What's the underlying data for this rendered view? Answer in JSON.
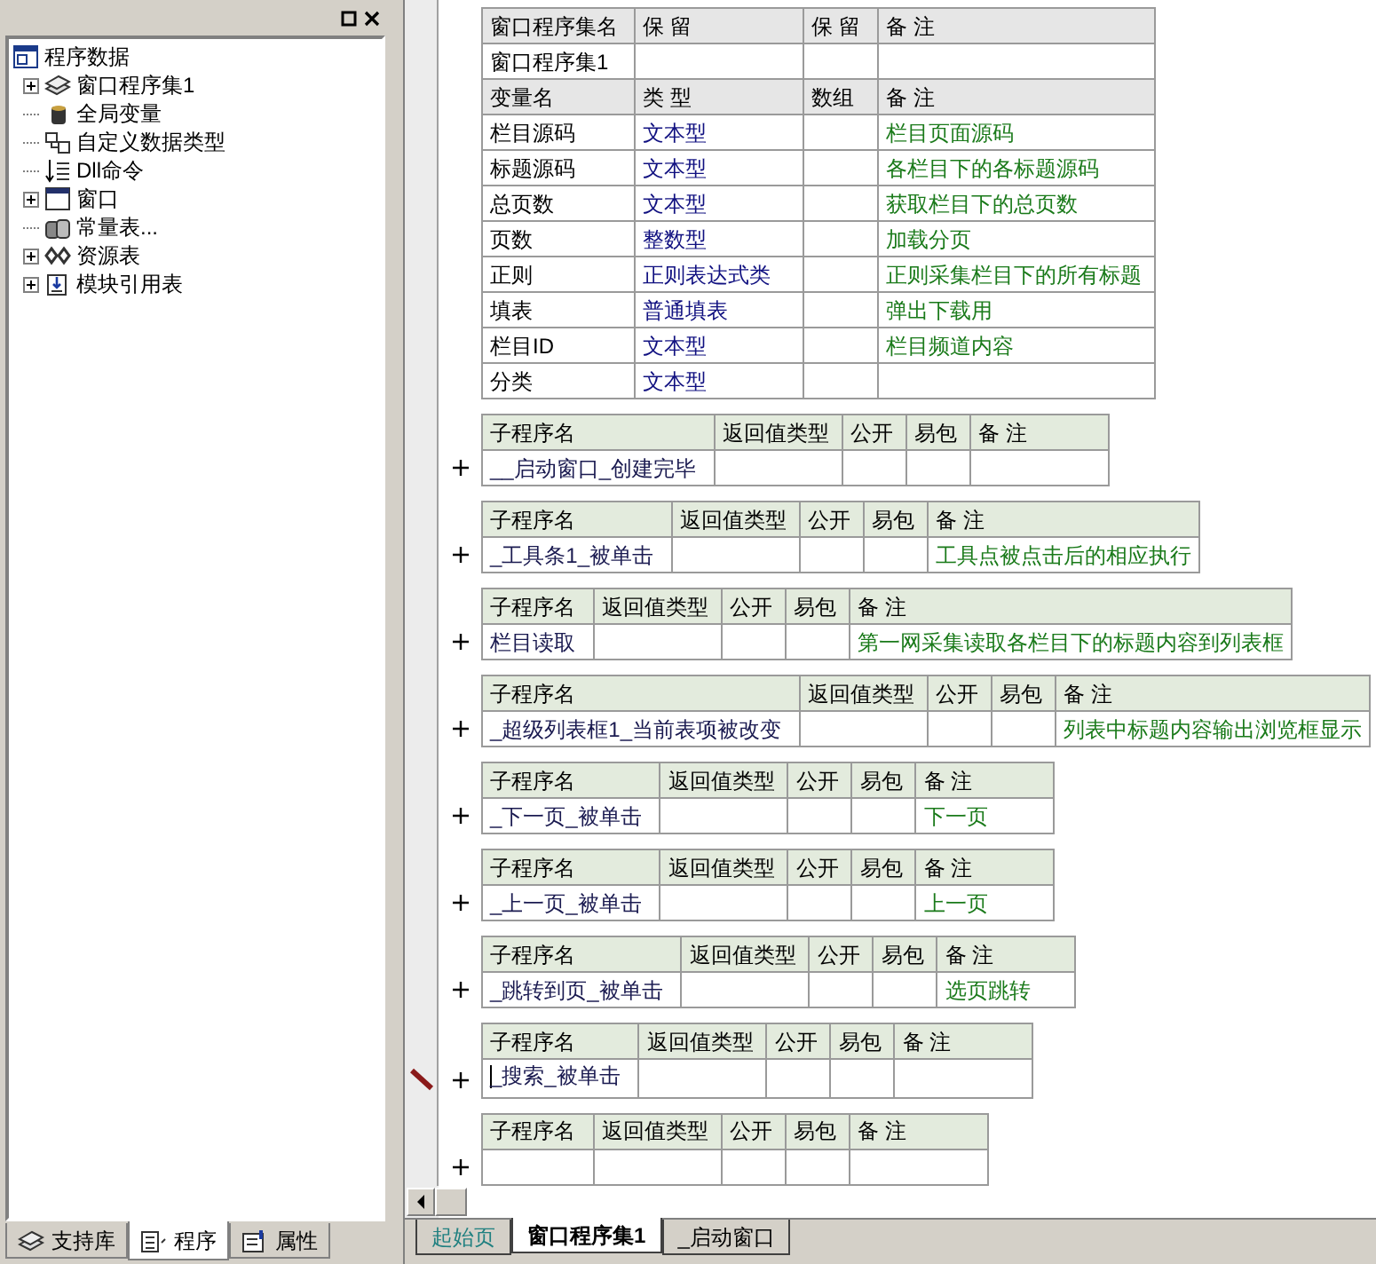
{
  "left_panel": {
    "tree": [
      {
        "label": "程序数据",
        "kind": "root",
        "children": [
          {
            "label": "窗口程序集1",
            "kind": "program-set",
            "expanded": false
          },
          {
            "label": "全局变量",
            "kind": "global-vars"
          },
          {
            "label": "自定义数据类型",
            "kind": "custom-type"
          },
          {
            "label": "Dll命令",
            "kind": "dll"
          },
          {
            "label": "窗口",
            "kind": "window",
            "expanded": false
          },
          {
            "label": "常量表...",
            "kind": "constants"
          },
          {
            "label": "资源表",
            "kind": "resources",
            "expanded": false
          },
          {
            "label": "模块引用表",
            "kind": "modules",
            "expanded": false
          }
        ]
      }
    ],
    "tabs": [
      {
        "label": "支持库",
        "kind": "library",
        "selected": false
      },
      {
        "label": "程序",
        "kind": "program",
        "selected": true
      },
      {
        "label": "属性",
        "kind": "properties",
        "selected": false
      }
    ]
  },
  "editor": {
    "program_set": {
      "columns": [
        "窗口程序集名",
        "保 留",
        "保 留",
        "备 注"
      ],
      "name": "窗口程序集1",
      "variable_columns": [
        "变量名",
        "类 型",
        "数组",
        "备 注"
      ],
      "variables": [
        {
          "name": "栏目源码",
          "type": "文本型",
          "comment": "栏目页面源码"
        },
        {
          "name": "标题源码",
          "type": "文本型",
          "comment": "各栏目下的各标题源码"
        },
        {
          "name": "总页数",
          "type": "文本型",
          "comment": "获取栏目下的总页数"
        },
        {
          "name": "页数",
          "type": "整数型",
          "comment": "加载分页"
        },
        {
          "name": "正则",
          "type": "正则表达式类",
          "comment": "正则采集栏目下的所有标题"
        },
        {
          "name": "填表",
          "type": "普通填表",
          "comment": "弹出下载用"
        },
        {
          "name": "栏目ID",
          "type": "文本型",
          "comment": "栏目频道内容"
        },
        {
          "name": "分类",
          "type": "文本型"
        }
      ]
    },
    "subroutines": [
      {
        "columns": [
          "子程序名",
          "返回值类型",
          "公开",
          "易包",
          "备 注"
        ],
        "name": "__启动窗口_创建完毕",
        "editing": false
      },
      {
        "columns": [
          "子程序名",
          "返回值类型",
          "公开",
          "易包",
          "备 注"
        ],
        "name": "_工具条1_被单击",
        "comment": "工具点被点击后的相应执行",
        "editing": false
      },
      {
        "columns": [
          "子程序名",
          "返回值类型",
          "公开",
          "易包",
          "备 注"
        ],
        "name": "栏目读取",
        "comment": "第一网采集读取各栏目下的标题内容到列表框",
        "editing": false
      },
      {
        "columns": [
          "子程序名",
          "返回值类型",
          "公开",
          "易包",
          "备 注"
        ],
        "name": "_超级列表框1_当前表项被改变",
        "comment": "列表中标题内容输出浏览框显示",
        "editing": false
      },
      {
        "columns": [
          "子程序名",
          "返回值类型",
          "公开",
          "易包",
          "备 注"
        ],
        "name": "_下一页_被单击",
        "comment": "下一页",
        "editing": false
      },
      {
        "columns": [
          "子程序名",
          "返回值类型",
          "公开",
          "易包",
          "备 注"
        ],
        "name": "_上一页_被单击",
        "comment": "上一页",
        "editing": false
      },
      {
        "columns": [
          "子程序名",
          "返回值类型",
          "公开",
          "易包",
          "备 注"
        ],
        "name": "_跳转到页_被单击",
        "comment": "选页跳转",
        "editing": false
      },
      {
        "columns": [
          "子程序名",
          "返回值类型",
          "公开",
          "易包",
          "备 注"
        ],
        "name": "_搜索_被单击",
        "editing": true
      },
      {
        "columns": [
          "子程序名",
          "返回值类型",
          "公开",
          "易包",
          "备 注"
        ],
        "editing": false
      }
    ]
  },
  "doc_tabs": [
    {
      "label": "起始页",
      "kind": "start",
      "selected": false
    },
    {
      "label": "窗口程序集1",
      "kind": "code",
      "selected": true
    },
    {
      "label": "_启动窗口",
      "kind": "code",
      "selected": false
    }
  ]
}
